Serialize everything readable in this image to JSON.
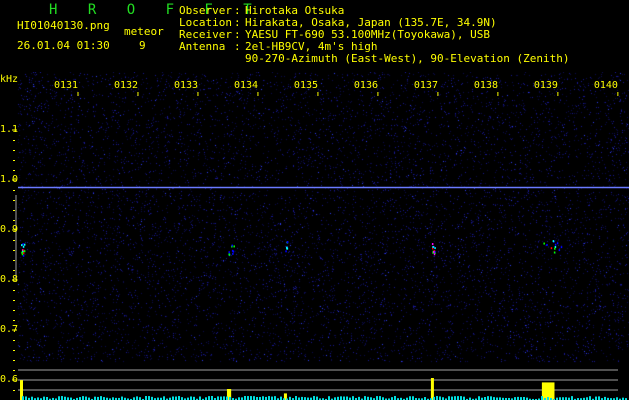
{
  "header": {
    "app_title": "H R O F F T",
    "filename": "HI01040130.png",
    "datetime": "26.01.04 01:30",
    "meteor_label": "meteor",
    "meteor_count": "9",
    "info": [
      {
        "key": "Observer ",
        "value": "Hirotaka Otsuka"
      },
      {
        "key": "Location ",
        "value": "Hirakata, Osaka, Japan (135.7E, 34.9N)"
      },
      {
        "key": "Receiver ",
        "value": "YAESU FT-690 53.100MHz(Toyokawa), USB"
      },
      {
        "key": "Antenna  ",
        "value": "2el-HB9CV, 4m's high"
      },
      {
        "key": "",
        "value": "90-270-Azimuth (East-West), 90-Elevation (Zenith)"
      }
    ]
  },
  "colors": {
    "text": "#ffff00",
    "title": "#22dd22",
    "noise": "#1a1a9a",
    "signal": "#00ffff",
    "grid": "#a0a0a0"
  },
  "chart_data": {
    "type": "heatmap",
    "title": "HROFFT spectrogram",
    "ylabel": "kHz",
    "xlabel": "",
    "x_ticks": [
      "0131",
      "0132",
      "0133",
      "0134",
      "0135",
      "0136",
      "0137",
      "0138",
      "0139",
      "0140"
    ],
    "x_range_minutes": [
      130,
      140
    ],
    "y_ticks": [
      "1.1",
      "1.0",
      "0.9",
      "0.8",
      "0.7",
      "0.6"
    ],
    "ylim": [
      0.58,
      1.2
    ],
    "carrier_khz": 0.985,
    "echoes": [
      {
        "minute": 130.05,
        "khz": 0.86,
        "strength": 0.9,
        "duration_min": 0.05
      },
      {
        "minute": 133.5,
        "khz": 0.86,
        "strength": 0.5,
        "duration_min": 0.1
      },
      {
        "minute": 134.45,
        "khz": 0.87,
        "strength": 0.3,
        "duration_min": 0.02
      },
      {
        "minute": 136.9,
        "khz": 0.86,
        "strength": 1.0,
        "duration_min": 0.05
      },
      {
        "minute": 138.75,
        "khz": 0.865,
        "strength": 0.8,
        "duration_min": 0.3
      }
    ]
  }
}
